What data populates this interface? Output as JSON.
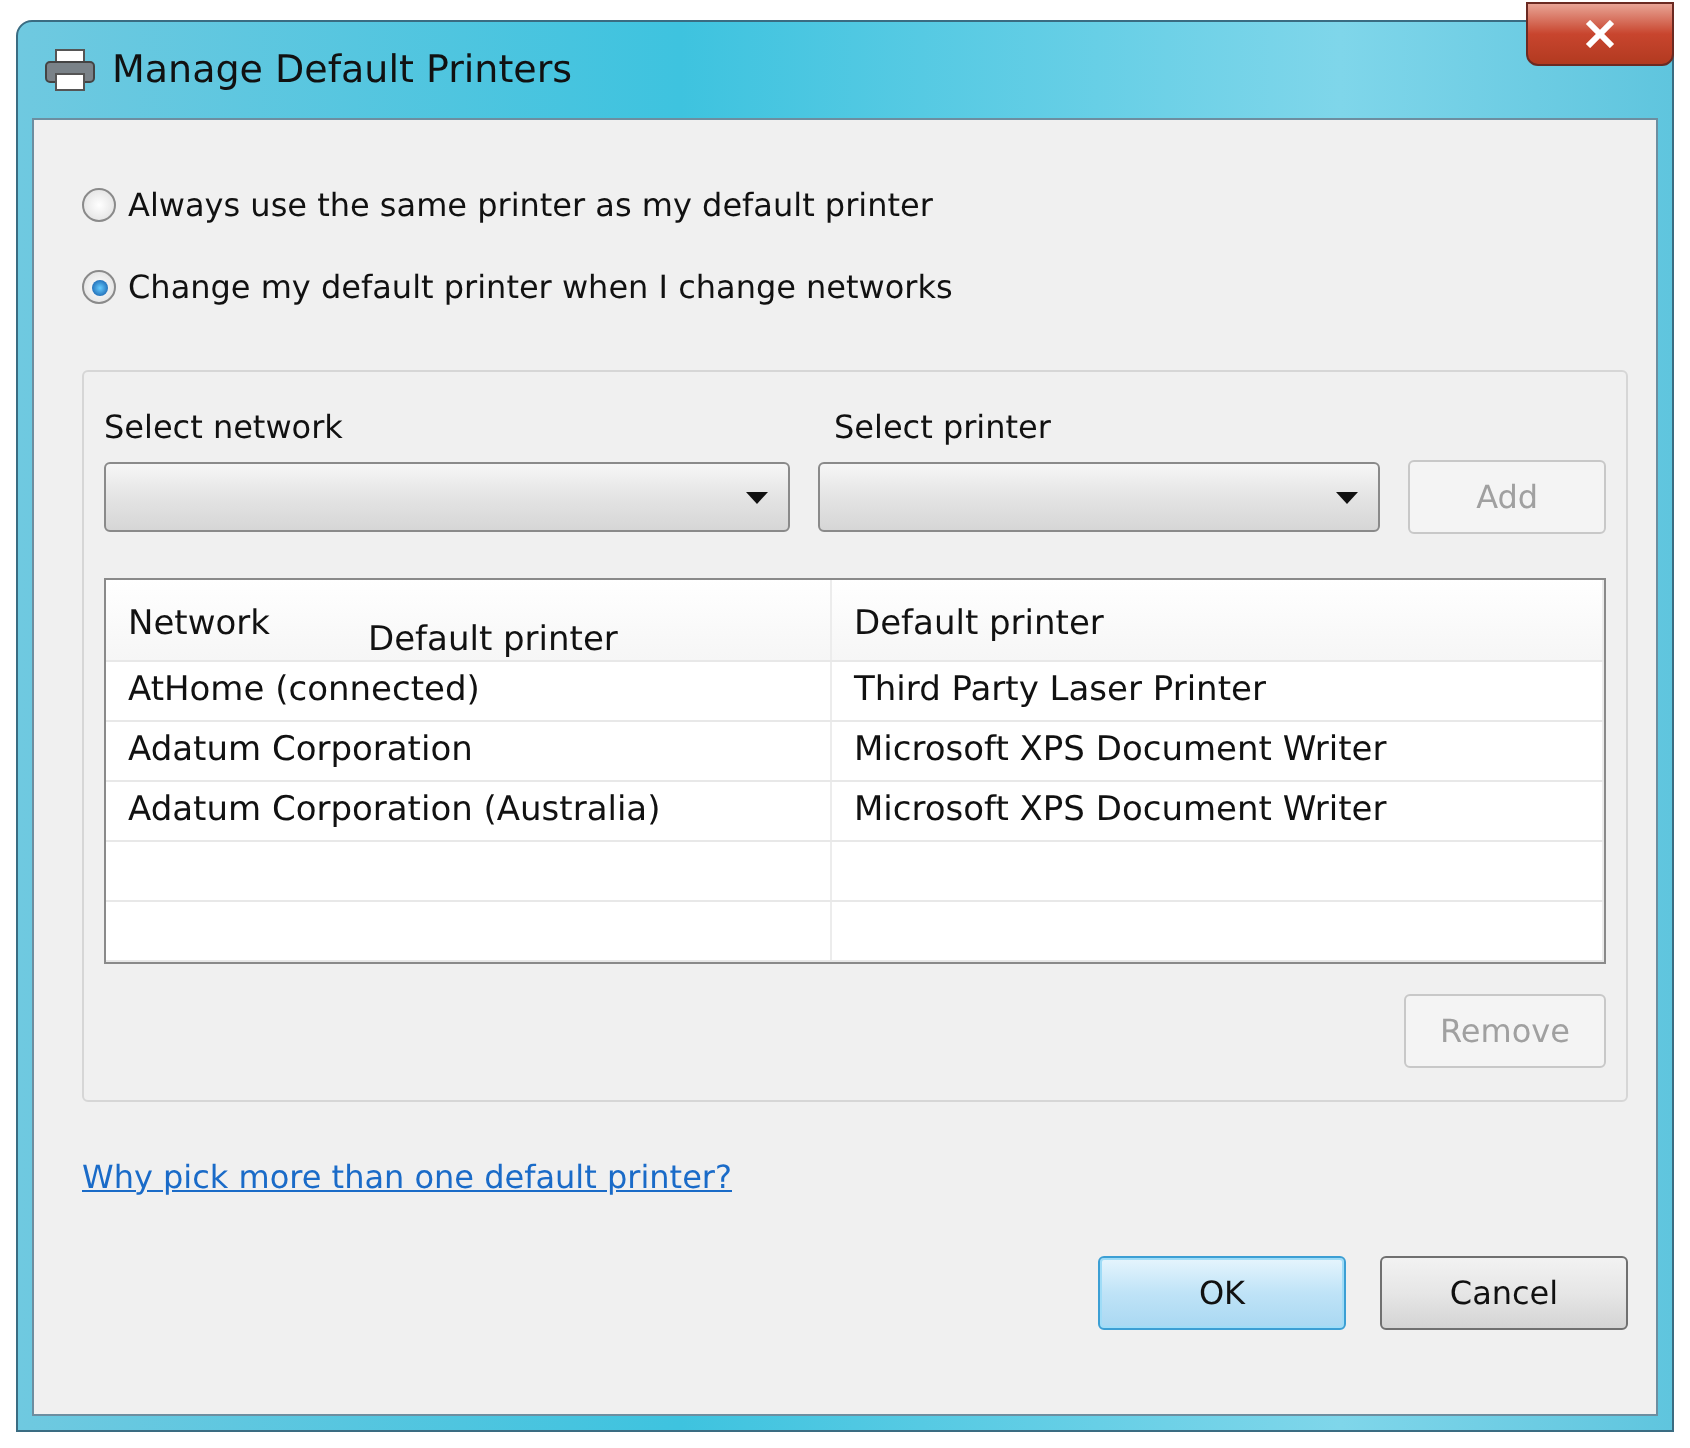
{
  "window": {
    "title": "Manage Default Printers"
  },
  "options": [
    {
      "label": "Always use the same printer as my default printer",
      "selected": false
    },
    {
      "label": "Change my default printer when I change networks",
      "selected": true
    }
  ],
  "network_select": {
    "label": "Select network"
  },
  "printer_select": {
    "label": "Select printer"
  },
  "add_button": {
    "label": "Add",
    "disabled": true
  },
  "table": {
    "columns": [
      "Network",
      "Default printer"
    ],
    "stray_header_label": "Default printer",
    "rows": [
      {
        "network": "AtHome (connected)",
        "printer": "Third Party Laser Printer"
      },
      {
        "network": "Adatum Corporation",
        "printer": "Microsoft XPS Document Writer"
      },
      {
        "network": "Adatum Corporation (Australia)",
        "printer": "Microsoft XPS Document Writer"
      }
    ]
  },
  "remove_button": {
    "label": "Remove",
    "disabled": true
  },
  "help_link": "Why pick more than one default printer?",
  "buttons": [
    {
      "label": "OK",
      "kind": "default"
    },
    {
      "label": "Cancel",
      "kind": "normal"
    }
  ]
}
